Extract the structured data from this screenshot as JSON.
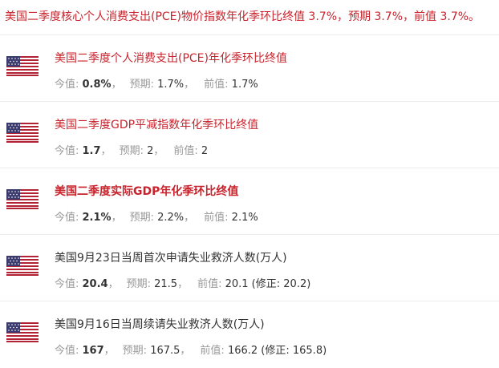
{
  "header": {
    "text": "美国二季度核心个人消费支出(PCE)物价指数年化季环比终值 3.7%，预期 3.7%，前值 3.7%。"
  },
  "labels": {
    "actual": "今值: ",
    "forecast": "预期: ",
    "previous": "前值: ",
    "sep": "，"
  },
  "colors": {
    "accent_red": "#c8232c",
    "text_dark": "#333333",
    "text_gray": "#999999"
  },
  "items": [
    {
      "flag": "us-flag-icon",
      "title": "美国二季度个人消费支出(PCE)年化季环比终值",
      "actual": "0.8%",
      "forecast": "1.7%",
      "previous": "1.7%"
    },
    {
      "flag": "us-flag-icon",
      "title": "美国二季度GDP平减指数年化季环比终值",
      "actual": "1.7",
      "forecast": "2",
      "previous": "2"
    },
    {
      "flag": "us-flag-icon",
      "title": "美国二季度实际GDP年化季环比终值",
      "actual": "2.1%",
      "forecast": "2.2%",
      "previous": "2.1%"
    },
    {
      "flag": "us-flag-icon",
      "title": "美国9月23日当周首次申请失业救济人数(万人)",
      "actual": "20.4",
      "forecast": "21.5",
      "previous": "20.1 (修正: 20.2)"
    },
    {
      "flag": "us-flag-icon",
      "title": "美国9月16日当周续请失业救济人数(万人)",
      "actual": "167",
      "forecast": "167.5",
      "previous": "166.2 (修正: 165.8)"
    }
  ]
}
